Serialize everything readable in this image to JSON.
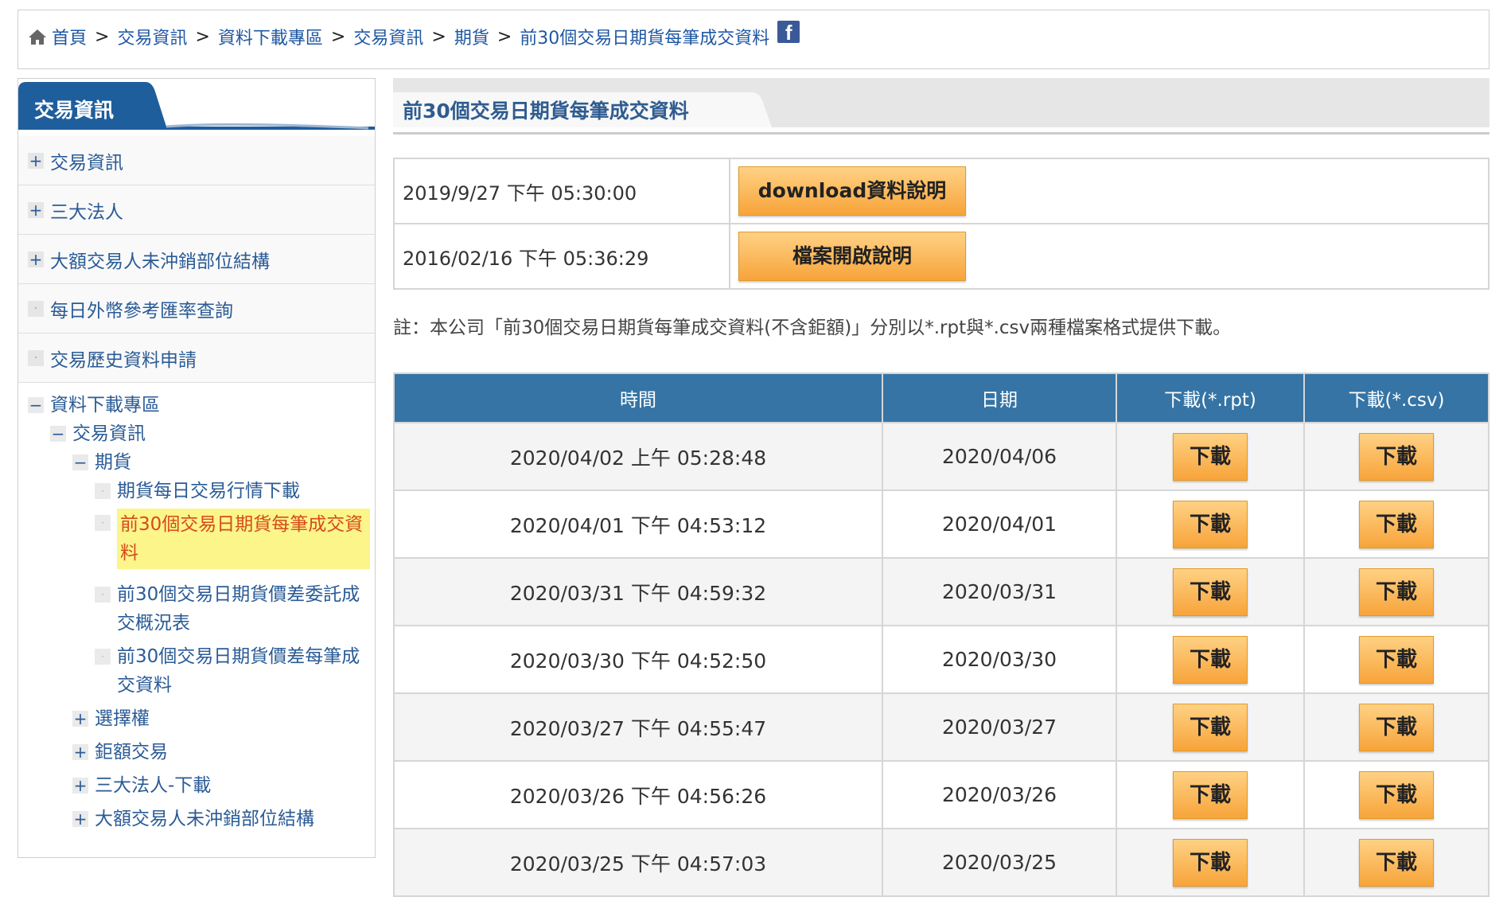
{
  "breadcrumb": {
    "items": [
      "首頁",
      "交易資訊",
      "資料下載專區",
      "交易資訊",
      "期貨",
      "前30個交易日期貨每筆成交資料"
    ],
    "separator": ">"
  },
  "sidebar": {
    "title": "交易資訊",
    "items": [
      {
        "label": "交易資訊",
        "icon": "plus"
      },
      {
        "label": "三大法人",
        "icon": "plus"
      },
      {
        "label": "大額交易人未沖銷部位結構",
        "icon": "plus"
      },
      {
        "label": "每日外幣參考匯率查詢",
        "icon": "dot"
      },
      {
        "label": "交易歷史資料申請",
        "icon": "dot"
      }
    ],
    "tree": {
      "root": "資料下載專區",
      "level1": "交易資訊",
      "level2": "期貨",
      "leaves": [
        {
          "label": "期貨每日交易行情下載"
        },
        {
          "label": "前30個交易日期貨每筆成交資料",
          "active": true
        },
        {
          "label": "前30個交易日期貨價差委託成交概況表"
        },
        {
          "label": "前30個交易日期貨價差每筆成交資料"
        }
      ],
      "siblings": [
        "選擇權",
        "鉅額交易",
        "三大法人-下載",
        "大額交易人未沖銷部位結構"
      ]
    }
  },
  "main": {
    "title": "前30個交易日期貨每筆成交資料",
    "info": [
      {
        "timestamp": "2019/9/27 下午 05:30:00",
        "button": "download資料說明"
      },
      {
        "timestamp": "2016/02/16 下午 05:36:29",
        "button": "檔案開啟說明"
      }
    ],
    "note": "註：本公司「前30個交易日期貨每筆成交資料(不含鉅額)」分別以*.rpt與*.csv兩種檔案格式提供下載。",
    "table": {
      "headers": [
        "時間",
        "日期",
        "下載(*.rpt)",
        "下載(*.csv)"
      ],
      "download_label": "下載",
      "rows": [
        {
          "time": "2020/04/02 上午 05:28:48",
          "date": "2020/04/06"
        },
        {
          "time": "2020/04/01 下午 04:53:12",
          "date": "2020/04/01"
        },
        {
          "time": "2020/03/31 下午 04:59:32",
          "date": "2020/03/31"
        },
        {
          "time": "2020/03/30 下午 04:52:50",
          "date": "2020/03/30"
        },
        {
          "time": "2020/03/27 下午 04:55:47",
          "date": "2020/03/27"
        },
        {
          "time": "2020/03/26 下午 04:56:26",
          "date": "2020/03/26"
        },
        {
          "time": "2020/03/25 下午 04:57:03",
          "date": "2020/03/25"
        }
      ]
    }
  },
  "colors": {
    "header_blue": "#3574a5",
    "sidebar_blue": "#1f5e9c",
    "link_blue": "#1f57a3",
    "active_bg": "#fbf58a",
    "active_text": "#d64a1b",
    "button_orange": "#f7a43a"
  }
}
